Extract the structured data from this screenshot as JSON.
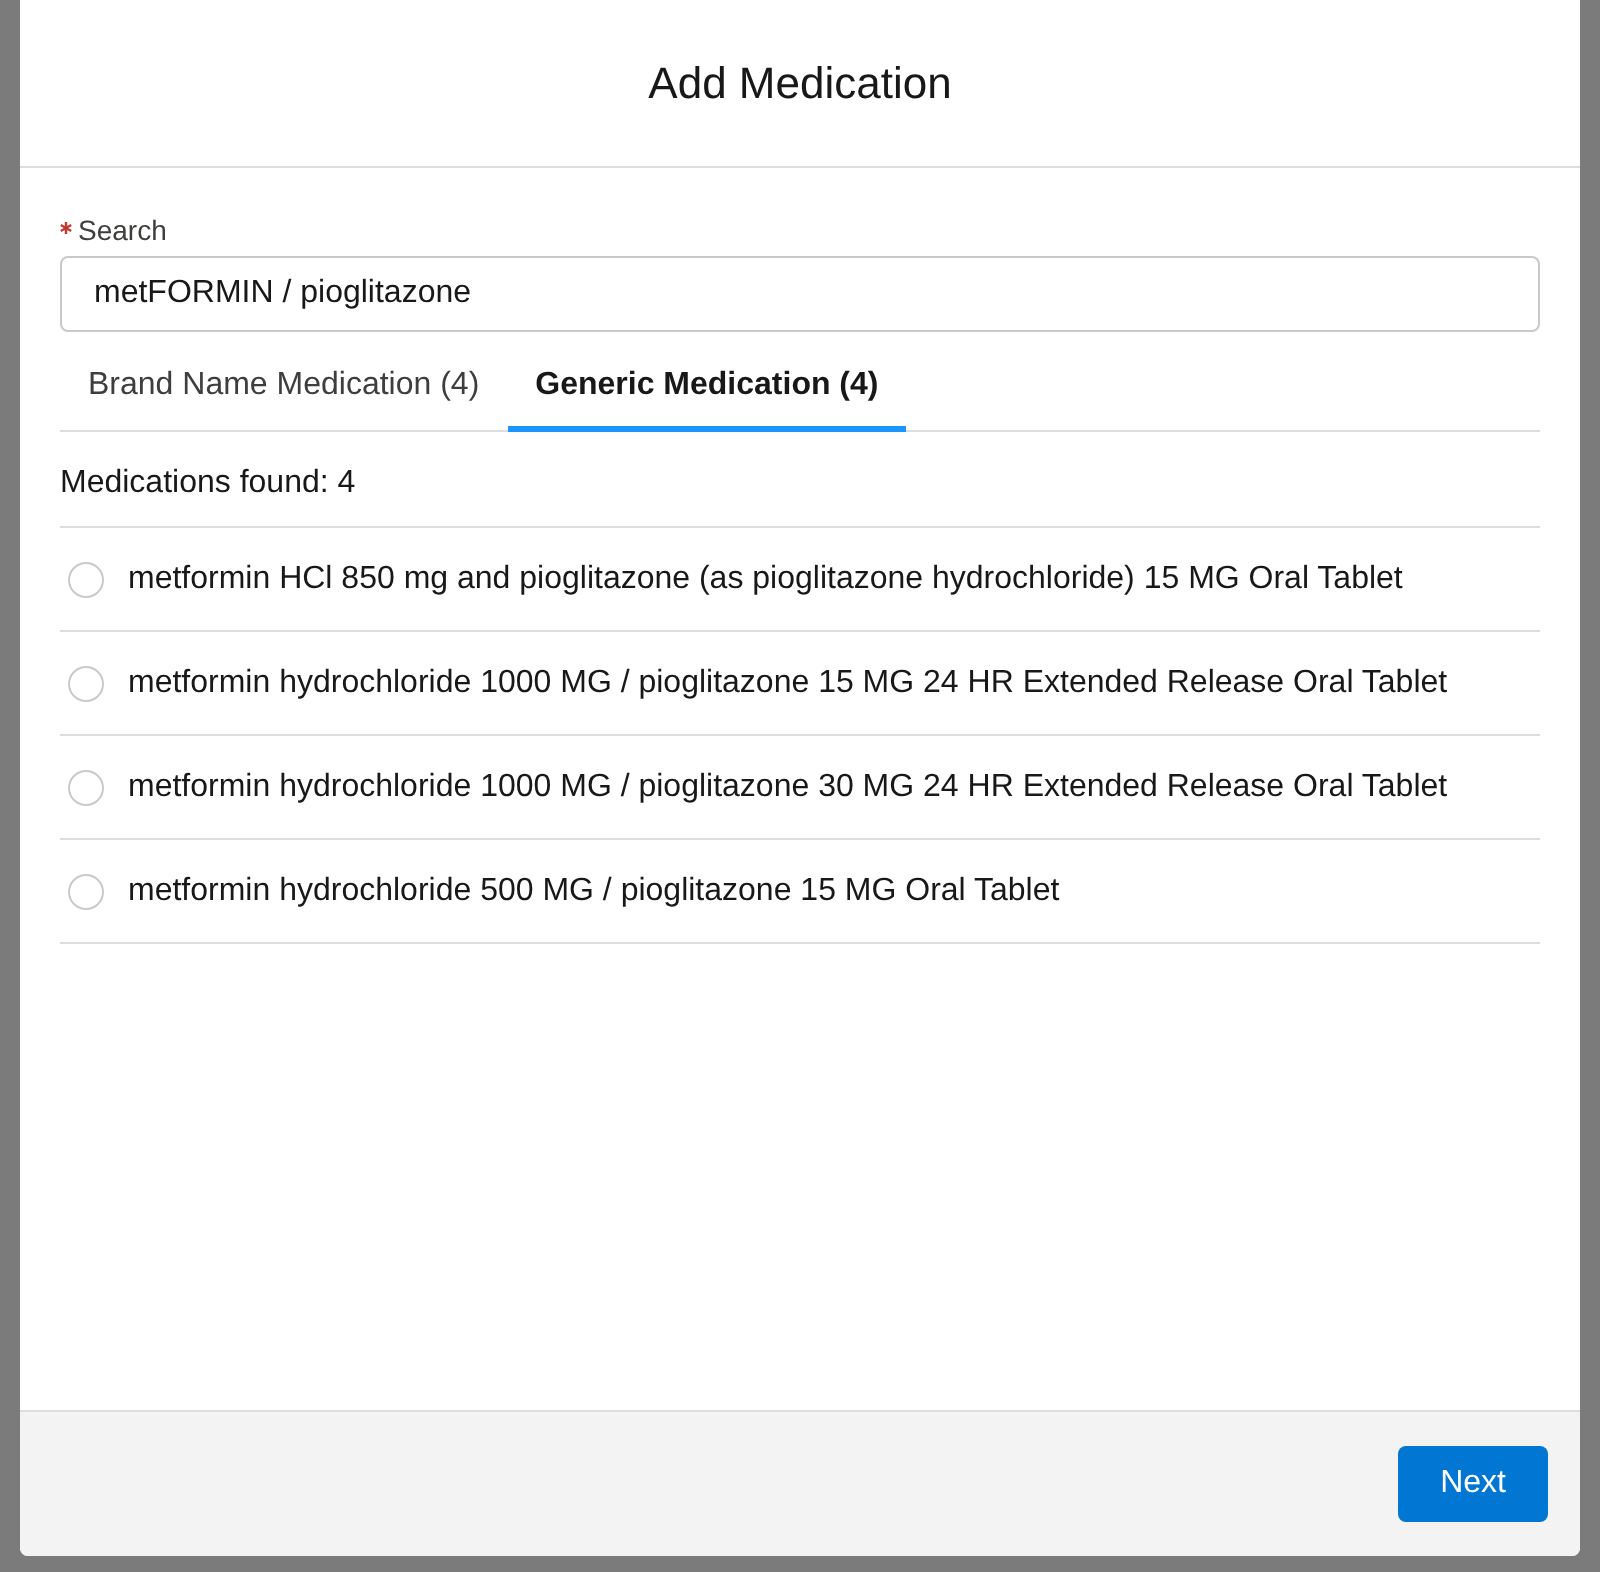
{
  "modal": {
    "title": "Add Medication"
  },
  "search": {
    "label": "Search",
    "required": true,
    "value": "metFORMIN / pioglitazone"
  },
  "tabs": [
    {
      "label": "Brand Name Medication (4)",
      "selected": false
    },
    {
      "label": "Generic Medication (4)",
      "selected": true
    }
  ],
  "results_count": "Medications found: 4",
  "medications": [
    {
      "name": "metformin HCl 850 mg and pioglitazone (as pioglitazone hydrochloride) 15 MG Oral Tablet",
      "selected": false
    },
    {
      "name": "metformin hydrochloride 1000 MG / pioglitazone 15 MG 24 HR Extended Release Oral Tablet",
      "selected": false
    },
    {
      "name": "metformin hydrochloride 1000 MG / pioglitazone 30 MG 24 HR Extended Release Oral Tablet",
      "selected": false
    },
    {
      "name": "metformin hydrochloride 500 MG / pioglitazone 15 MG Oral Tablet",
      "selected": false
    }
  ],
  "footer": {
    "buttons": [
      "Next"
    ]
  }
}
